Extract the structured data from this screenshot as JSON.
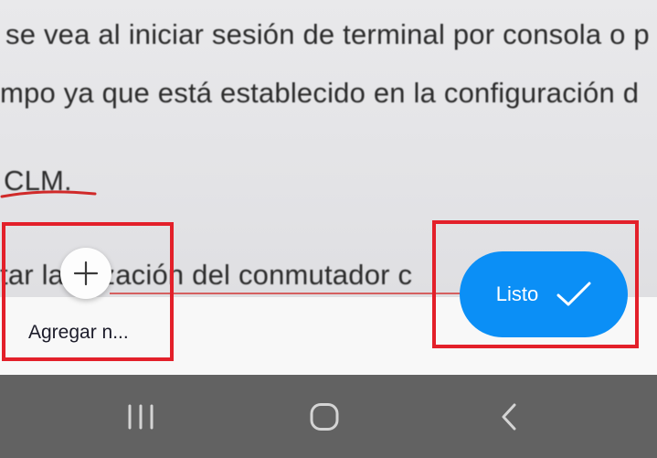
{
  "document_photo": {
    "lines": [
      "se vea al iniciar sesión de terminal por consola o p",
      "mpo ya que está establecido en la configuración d",
      "CLM.",
      "tar la   alización del conmutador c"
    ]
  },
  "actions": {
    "add_label": "Agregar n...",
    "done_label": "Listo"
  },
  "icons": {
    "add": "plus-icon",
    "done": "checkmark-icon",
    "recents": "recents-icon",
    "home": "home-icon",
    "back": "back-icon"
  },
  "colors": {
    "accent": "#0b8ff6",
    "highlight": "#e3202a",
    "navbar": "#626262"
  }
}
